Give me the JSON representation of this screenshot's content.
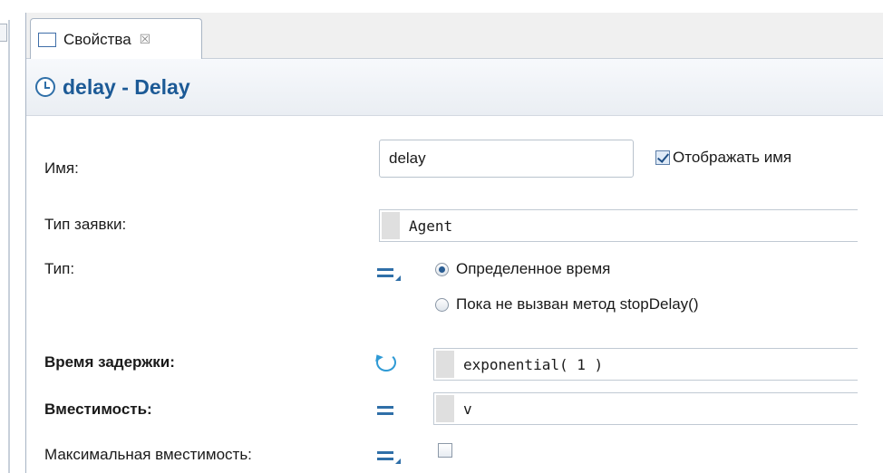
{
  "tab": {
    "label": "Свойства",
    "close_glyph": "☒",
    "icon": "properties-table-icon"
  },
  "header": {
    "title": "delay - Delay",
    "icon": "clock-icon"
  },
  "fields": {
    "name": {
      "label": "Имя:",
      "value": "delay",
      "show_name_label": "Отображать имя",
      "show_name_checked": true
    },
    "agent_type": {
      "label": "Тип заявки:",
      "value": "Agent"
    },
    "type": {
      "label": "Тип:",
      "options": [
        "Определенное время",
        "Пока не вызван метод stopDelay()"
      ],
      "selected_index": 0
    },
    "delay_time": {
      "label": "Время задержки:",
      "value": "exponential( 1 )"
    },
    "capacity": {
      "label": "Вместимость:",
      "value": "v"
    },
    "max_capacity": {
      "label": "Максимальная вместимость:",
      "checked": false
    }
  },
  "colors": {
    "title_blue": "#1c5a96",
    "icon_blue": "#2f6fa8",
    "loop_icon": "#2f9ad5"
  }
}
